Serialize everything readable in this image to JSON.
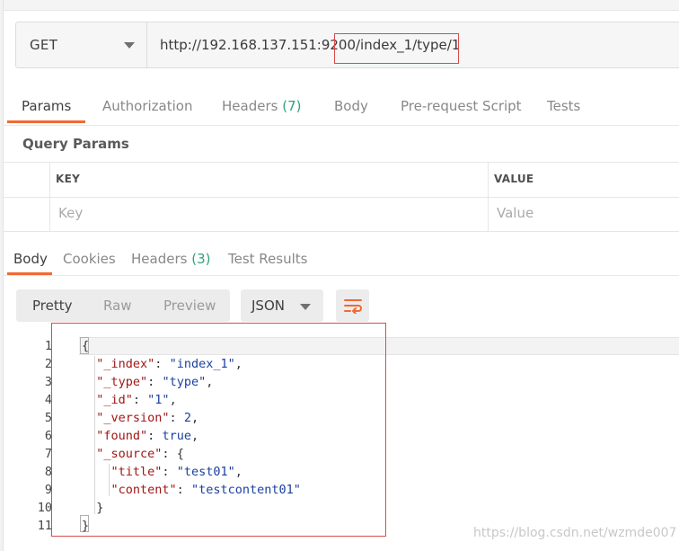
{
  "request": {
    "method": "GET",
    "url": "http://192.168.137.151:9200/index_1/type/1"
  },
  "request_tabs": [
    {
      "label": "Params",
      "active": true
    },
    {
      "label": "Authorization"
    },
    {
      "label": "Headers",
      "count": "(7)"
    },
    {
      "label": "Body"
    },
    {
      "label": "Pre-request Script"
    },
    {
      "label": "Tests"
    }
  ],
  "query_params": {
    "title": "Query Params",
    "columns": [
      "KEY",
      "VALUE"
    ],
    "placeholders": [
      "Key",
      "Value"
    ]
  },
  "response_tabs": [
    {
      "label": "Body",
      "active": true
    },
    {
      "label": "Cookies"
    },
    {
      "label": "Headers",
      "count": "(3)"
    },
    {
      "label": "Test Results"
    }
  ],
  "view_modes": [
    {
      "label": "Pretty",
      "active": true
    },
    {
      "label": "Raw"
    },
    {
      "label": "Preview"
    }
  ],
  "format": "JSON",
  "wrap_icon": "wrap-lines-icon",
  "line_numbers": [
    "1",
    "2",
    "3",
    "4",
    "5",
    "6",
    "7",
    "8",
    "9",
    "10",
    "11"
  ],
  "json_lines": [
    {
      "key": null,
      "value": "{"
    },
    {
      "key": "\"_index\"",
      "value": "\"index_1\""
    },
    {
      "key": "\"_type\"",
      "value": "\"type\""
    },
    {
      "key": "\"_id\"",
      "value": "\"1\""
    },
    {
      "key": "\"_version\"",
      "value": "2"
    },
    {
      "key": "\"found\"",
      "value": "true"
    },
    {
      "key": "\"_source\"",
      "value": "{"
    },
    {
      "key": "\"title\"",
      "value": "\"test01\""
    },
    {
      "key": "\"content\"",
      "value": "\"testcontent01\""
    },
    {
      "key": null,
      "value": "}"
    },
    {
      "key": null,
      "value": "}"
    }
  ],
  "watermark": "https://blog.csdn.net/wzmde007",
  "colors": {
    "accent": "#f06a33",
    "count": "#2fa27a",
    "highlight_box": "#d84c4c",
    "json_key": "#a31515",
    "json_value": "#1a3fa0"
  }
}
